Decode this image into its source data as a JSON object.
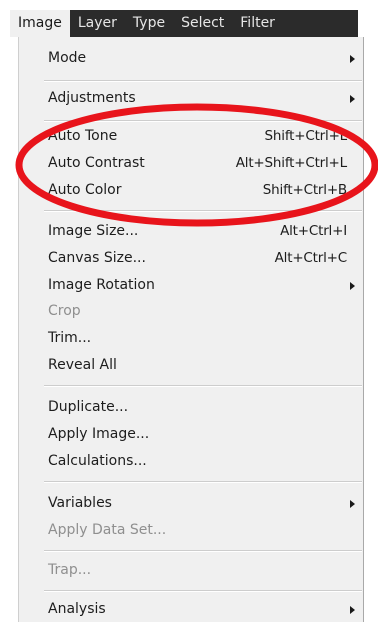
{
  "menubar": {
    "items": [
      {
        "label": "Image",
        "active": true
      },
      {
        "label": "Layer",
        "active": false
      },
      {
        "label": "Type",
        "active": false
      },
      {
        "label": "Select",
        "active": false
      },
      {
        "label": "Filter",
        "active": false
      }
    ]
  },
  "menu": {
    "items": [
      {
        "label": "Mode",
        "shortcut": "",
        "submenu": true,
        "disabled": false
      },
      {
        "label": "Adjustments",
        "shortcut": "",
        "submenu": true,
        "disabled": false
      },
      {
        "label": "Auto Tone",
        "shortcut": "Shift+Ctrl+L",
        "submenu": false,
        "disabled": false
      },
      {
        "label": "Auto Contrast",
        "shortcut": "Alt+Shift+Ctrl+L",
        "submenu": false,
        "disabled": false
      },
      {
        "label": "Auto Color",
        "shortcut": "Shift+Ctrl+B",
        "submenu": false,
        "disabled": false
      },
      {
        "label": "Image Size...",
        "shortcut": "Alt+Ctrl+I",
        "submenu": false,
        "disabled": false
      },
      {
        "label": "Canvas Size...",
        "shortcut": "Alt+Ctrl+C",
        "submenu": false,
        "disabled": false
      },
      {
        "label": "Image Rotation",
        "shortcut": "",
        "submenu": true,
        "disabled": false
      },
      {
        "label": "Crop",
        "shortcut": "",
        "submenu": false,
        "disabled": true
      },
      {
        "label": "Trim...",
        "shortcut": "",
        "submenu": false,
        "disabled": false
      },
      {
        "label": "Reveal All",
        "shortcut": "",
        "submenu": false,
        "disabled": false
      },
      {
        "label": "Duplicate...",
        "shortcut": "",
        "submenu": false,
        "disabled": false
      },
      {
        "label": "Apply Image...",
        "shortcut": "",
        "submenu": false,
        "disabled": false
      },
      {
        "label": "Calculations...",
        "shortcut": "",
        "submenu": false,
        "disabled": false
      },
      {
        "label": "Variables",
        "shortcut": "",
        "submenu": true,
        "disabled": false
      },
      {
        "label": "Apply Data Set...",
        "shortcut": "",
        "submenu": false,
        "disabled": true
      },
      {
        "label": "Trap...",
        "shortcut": "",
        "submenu": false,
        "disabled": true
      },
      {
        "label": "Analysis",
        "shortcut": "",
        "submenu": true,
        "disabled": false
      }
    ]
  },
  "colors": {
    "menubar_bg": "#2b2b2b",
    "menu_bg": "#f0f0f0",
    "highlight": "#e8141b",
    "disabled_text": "#8f8f8f"
  },
  "icons": {
    "submenu": "submenu-arrow-icon"
  }
}
